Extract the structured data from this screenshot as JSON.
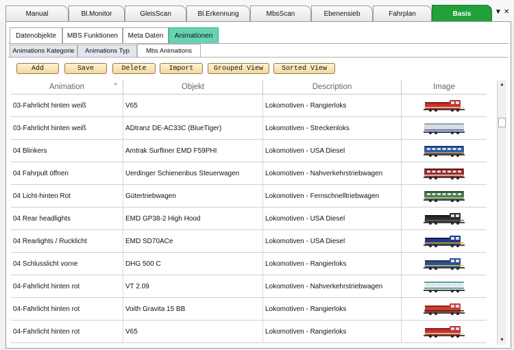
{
  "top_tabs": [
    "Manual",
    "Bl.Monitor",
    "GleisScan",
    "Bl.Erkennung",
    "MbsScan",
    "Ebenensieb",
    "Fahrplan",
    "Basis"
  ],
  "top_controls": {
    "dropdown": "▼",
    "close": "✕"
  },
  "level2_tabs": [
    "Datenobjekte",
    "MBS Funktionen",
    "Meta Daten",
    "Animationen"
  ],
  "level3_tabs": [
    "Animations Kategorie",
    "Animations Typ",
    "Mbs Animations"
  ],
  "buttons": [
    "Add",
    "Save",
    "Delete",
    "Import",
    "Grouped View",
    "Sorted View"
  ],
  "columns": {
    "animation": "Animation",
    "objekt": "Objekt",
    "description": "Description",
    "image": "Image"
  },
  "sort_indicator": "^",
  "rows": [
    {
      "animation": "03-Fahrlicht hinten weiß",
      "objekt": "V65",
      "description": "Lokomotiven - Rangierloks",
      "image": "loco-red-shunter"
    },
    {
      "animation": "03-Fahrlicht hinten weiß",
      "objekt": "ADtranz DE-AC33C (BlueTiger)",
      "description": "Lokomotiven - Streckenloks",
      "image": "loco-grey-long"
    },
    {
      "animation": "04 Blinkers",
      "objekt": "Amtrak Surfliner EMD F59PHI",
      "description": "Lokomotiven - USA Diesel",
      "image": "loco-blue-orange"
    },
    {
      "animation": "04 Fahrpult öffnen",
      "objekt": "Uerdinger Schienenbus Steuerwagen",
      "description": "Lokomotiven - Nahverkehrstriebwagen",
      "image": "railcar-red"
    },
    {
      "animation": "04 Licht-hinten Rot",
      "objekt": "Gütertriebwagen",
      "description": "Lokomotiven - Fernschnelltriebwagen",
      "image": "railcar-green"
    },
    {
      "animation": "04 Rear headlights",
      "objekt": "EMD GP38-2 High Hood",
      "description": "Lokomotiven - USA Diesel",
      "image": "loco-black"
    },
    {
      "animation": "04 Rearlights / Rucklicht",
      "objekt": "EMD SD70ACe",
      "description": "Lokomotiven - USA Diesel",
      "image": "loco-orange-blue"
    },
    {
      "animation": "04 Schlusslicht vorne",
      "objekt": "DHG 500 C",
      "description": "Lokomotiven - Rangierloks",
      "image": "loco-blue-shunter"
    },
    {
      "animation": "04-Fahrlicht hinten rot",
      "objekt": "VT 2.09",
      "description": "Lokomotiven - Nahverkehrstriebwagen",
      "image": "railcar-cream-teal"
    },
    {
      "animation": "04-Fahrlicht hinten rot",
      "objekt": "Voith Gravita 15 BB",
      "description": "Lokomotiven - Rangierloks",
      "image": "loco-red-gravita"
    },
    {
      "animation": "04-Fahrlicht hinten rot",
      "objekt": "V65",
      "description": "Lokomotiven - Rangierloks",
      "image": "loco-red-shunter"
    }
  ],
  "scrollbar": {
    "up": "▲",
    "down": "▼"
  }
}
